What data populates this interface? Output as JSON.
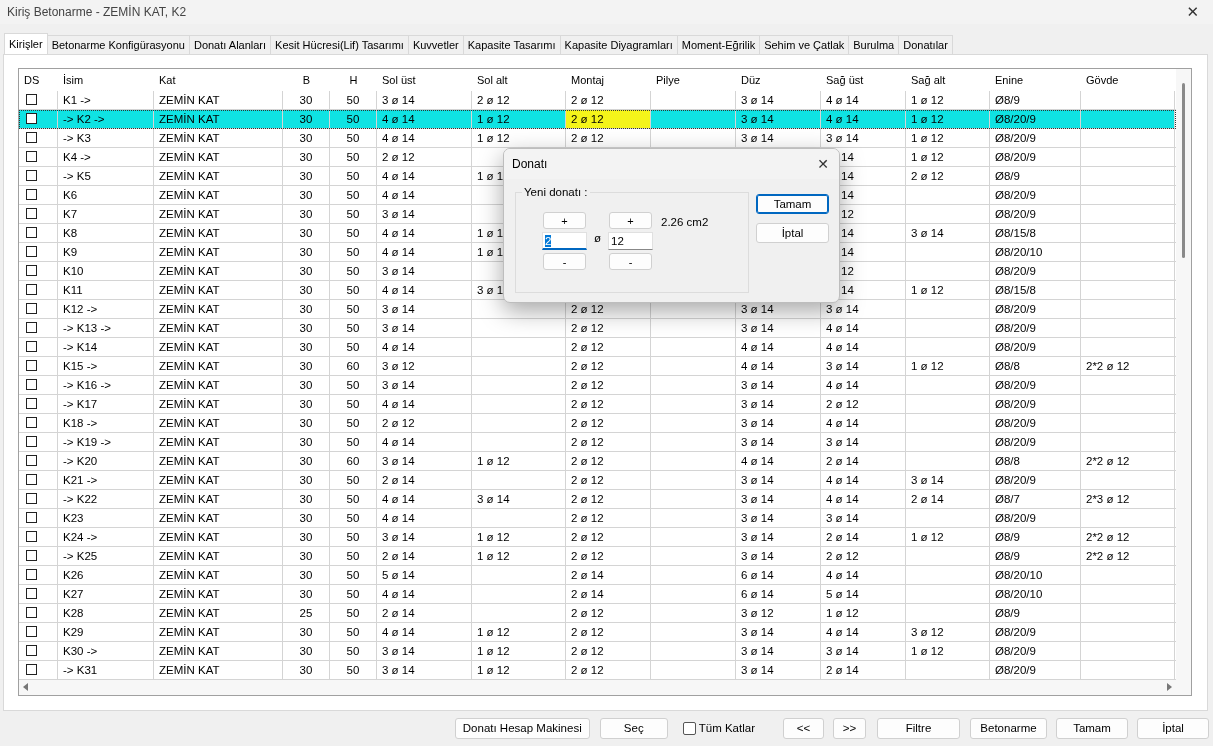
{
  "window": {
    "title": "Kiriş Betonarme - ZEMİN KAT, K2",
    "close": "✕"
  },
  "tabs": [
    {
      "label": "Kirişler",
      "selected": true
    },
    {
      "label": "Betonarme Konfigürasyonu",
      "selected": false
    },
    {
      "label": "Donatı Alanları",
      "selected": false
    },
    {
      "label": "Kesit Hücresi(Lif) Tasarımı",
      "selected": false
    },
    {
      "label": "Kuvvetler",
      "selected": false
    },
    {
      "label": "Kapasite Tasarımı",
      "selected": false
    },
    {
      "label": "Kapasite Diyagramları",
      "selected": false
    },
    {
      "label": "Moment-Eğrilik",
      "selected": false
    },
    {
      "label": "Sehim ve Çatlak",
      "selected": false
    },
    {
      "label": "Burulma",
      "selected": false
    },
    {
      "label": "Donatılar",
      "selected": false
    }
  ],
  "table": {
    "columns": [
      "DS",
      "İsim",
      "Kat",
      "B",
      "H",
      "Sol üst",
      "Sol alt",
      "Montaj",
      "Pilye",
      "Düz",
      "Sağ üst",
      "Sağ alt",
      "Enine",
      "Gövde"
    ],
    "rows": [
      {
        "selected": false,
        "cells": [
          {
            "checked": false
          },
          "K1 ->",
          "ZEMİN KAT",
          "30",
          "50",
          "3 ø 14",
          "2 ø 12",
          "2 ø 12",
          null,
          "3 ø 14",
          "4 ø 14",
          "1 ø 12",
          "Ø8/9",
          null
        ]
      },
      {
        "selected": true,
        "cells": [
          {
            "checked": false
          },
          "-> K2 ->",
          "ZEMİN KAT",
          "30",
          "50",
          "4 ø 14",
          "1 ø 12",
          {
            "text": "2 ø 12",
            "current": true
          },
          null,
          "3 ø 14",
          "4 ø 14",
          "1 ø 12",
          "Ø8/20/9",
          null
        ]
      },
      {
        "selected": false,
        "cells": [
          {
            "checked": false
          },
          "-> K3",
          "ZEMİN KAT",
          "30",
          "50",
          "4 ø 14",
          "1 ø 12",
          "2 ø 12",
          null,
          "3 ø 14",
          "3 ø 14",
          "1 ø 12",
          "Ø8/20/9",
          null
        ]
      },
      {
        "selected": false,
        "cells": [
          {
            "checked": false
          },
          "K4 ->",
          "ZEMİN KAT",
          "30",
          "50",
          "2 ø 12",
          null,
          null,
          null,
          null,
          {
            "text": "14",
            "clipped": true
          },
          "1 ø 12",
          "Ø8/20/9",
          null
        ]
      },
      {
        "selected": false,
        "cells": [
          {
            "checked": false
          },
          "-> K5",
          "ZEMİN KAT",
          "30",
          "50",
          "4 ø 14",
          "1 ø 1",
          null,
          null,
          null,
          {
            "text": "14",
            "clipped": true
          },
          "2 ø 12",
          "Ø8/9",
          null
        ]
      },
      {
        "selected": false,
        "cells": [
          {
            "checked": false
          },
          "K6",
          "ZEMİN KAT",
          "30",
          "50",
          "4 ø 14",
          null,
          null,
          null,
          null,
          {
            "text": "14",
            "clipped": true
          },
          null,
          "Ø8/20/9",
          null
        ]
      },
      {
        "selected": false,
        "cells": [
          {
            "checked": false
          },
          "K7",
          "ZEMİN KAT",
          "30",
          "50",
          "3 ø 14",
          null,
          null,
          null,
          null,
          {
            "text": "12",
            "clipped": true
          },
          null,
          "Ø8/20/9",
          null
        ]
      },
      {
        "selected": false,
        "cells": [
          {
            "checked": false
          },
          "K8",
          "ZEMİN KAT",
          "30",
          "50",
          "4 ø 14",
          "1 ø 1",
          null,
          null,
          null,
          {
            "text": "14",
            "clipped": true
          },
          "3 ø 14",
          "Ø8/15/8",
          null
        ]
      },
      {
        "selected": false,
        "cells": [
          {
            "checked": false
          },
          "K9",
          "ZEMİN KAT",
          "30",
          "50",
          "4 ø 14",
          "1 ø 1",
          null,
          null,
          null,
          {
            "text": "14",
            "clipped": true
          },
          null,
          "Ø8/20/10",
          null
        ]
      },
      {
        "selected": false,
        "cells": [
          {
            "checked": false
          },
          "K10",
          "ZEMİN KAT",
          "30",
          "50",
          "3 ø 14",
          null,
          null,
          null,
          null,
          {
            "text": "12",
            "clipped": true
          },
          null,
          "Ø8/20/9",
          null
        ]
      },
      {
        "selected": false,
        "cells": [
          {
            "checked": false
          },
          "K11",
          "ZEMİN KAT",
          "30",
          "50",
          "4 ø 14",
          "3 ø 1",
          null,
          null,
          null,
          {
            "text": "14",
            "clipped": true
          },
          "1 ø 12",
          "Ø8/15/8",
          null
        ]
      },
      {
        "selected": false,
        "cells": [
          {
            "checked": false
          },
          "K12 ->",
          "ZEMİN KAT",
          "30",
          "50",
          "3 ø 14",
          null,
          "2 ø 12",
          null,
          "3 ø 14",
          "3 ø 14",
          null,
          "Ø8/20/9",
          null
        ]
      },
      {
        "selected": false,
        "cells": [
          {
            "checked": false
          },
          "-> K13 ->",
          "ZEMİN KAT",
          "30",
          "50",
          "3 ø 14",
          null,
          "2 ø 12",
          null,
          "3 ø 14",
          "4 ø 14",
          null,
          "Ø8/20/9",
          null
        ]
      },
      {
        "selected": false,
        "cells": [
          {
            "checked": false
          },
          "-> K14",
          "ZEMİN KAT",
          "30",
          "50",
          "4 ø 14",
          null,
          "2 ø 12",
          null,
          "4 ø 14",
          "4 ø 14",
          null,
          "Ø8/20/9",
          null
        ]
      },
      {
        "selected": false,
        "cells": [
          {
            "checked": false
          },
          "K15 ->",
          "ZEMİN KAT",
          "30",
          "60",
          "3 ø 12",
          null,
          "2 ø 12",
          null,
          "4 ø 14",
          "3 ø 14",
          "1 ø 12",
          "Ø8/8",
          "2*2 ø 12"
        ]
      },
      {
        "selected": false,
        "cells": [
          {
            "checked": false
          },
          "-> K16 ->",
          "ZEMİN KAT",
          "30",
          "50",
          "3 ø 14",
          null,
          "2 ø 12",
          null,
          "3 ø 14",
          "4 ø 14",
          null,
          "Ø8/20/9",
          null
        ]
      },
      {
        "selected": false,
        "cells": [
          {
            "checked": false
          },
          "-> K17",
          "ZEMİN KAT",
          "30",
          "50",
          "4 ø 14",
          null,
          "2 ø 12",
          null,
          "3 ø 14",
          "2 ø 12",
          null,
          "Ø8/20/9",
          null
        ]
      },
      {
        "selected": false,
        "cells": [
          {
            "checked": false
          },
          "K18 ->",
          "ZEMİN KAT",
          "30",
          "50",
          "2 ø 12",
          null,
          "2 ø 12",
          null,
          "3 ø 14",
          "4 ø 14",
          null,
          "Ø8/20/9",
          null
        ]
      },
      {
        "selected": false,
        "cells": [
          {
            "checked": false
          },
          "-> K19 ->",
          "ZEMİN KAT",
          "30",
          "50",
          "4 ø 14",
          null,
          "2 ø 12",
          null,
          "3 ø 14",
          "3 ø 14",
          null,
          "Ø8/20/9",
          null
        ]
      },
      {
        "selected": false,
        "cells": [
          {
            "checked": false
          },
          "-> K20",
          "ZEMİN KAT",
          "30",
          "60",
          "3 ø 14",
          "1 ø 12",
          "2 ø 12",
          null,
          "4 ø 14",
          "2 ø 14",
          null,
          "Ø8/8",
          "2*2 ø 12"
        ]
      },
      {
        "selected": false,
        "cells": [
          {
            "checked": false
          },
          "K21 ->",
          "ZEMİN KAT",
          "30",
          "50",
          "2 ø 14",
          null,
          "2 ø 12",
          null,
          "3 ø 14",
          "4 ø 14",
          "3 ø 14",
          "Ø8/20/9",
          null
        ]
      },
      {
        "selected": false,
        "cells": [
          {
            "checked": false
          },
          "-> K22",
          "ZEMİN KAT",
          "30",
          "50",
          "4 ø 14",
          "3 ø 14",
          "2 ø 12",
          null,
          "3 ø 14",
          "4 ø 14",
          "2 ø 14",
          "Ø8/7",
          "2*3 ø 12"
        ]
      },
      {
        "selected": false,
        "cells": [
          {
            "checked": false
          },
          "K23",
          "ZEMİN KAT",
          "30",
          "50",
          "4 ø 14",
          null,
          "2 ø 12",
          null,
          "3 ø 14",
          "3 ø 14",
          null,
          "Ø8/20/9",
          null
        ]
      },
      {
        "selected": false,
        "cells": [
          {
            "checked": false
          },
          "K24 ->",
          "ZEMİN KAT",
          "30",
          "50",
          "3 ø 14",
          "1 ø 12",
          "2 ø 12",
          null,
          "3 ø 14",
          "2 ø 14",
          "1 ø 12",
          "Ø8/9",
          "2*2 ø 12"
        ]
      },
      {
        "selected": false,
        "cells": [
          {
            "checked": false
          },
          "-> K25",
          "ZEMİN KAT",
          "30",
          "50",
          "2 ø 14",
          "1 ø 12",
          "2 ø 12",
          null,
          "3 ø 14",
          "2 ø 12",
          null,
          "Ø8/9",
          "2*2 ø 12"
        ]
      },
      {
        "selected": false,
        "cells": [
          {
            "checked": false
          },
          "K26",
          "ZEMİN KAT",
          "30",
          "50",
          "5 ø 14",
          null,
          "2 ø 14",
          null,
          "6 ø 14",
          "4 ø 14",
          null,
          "Ø8/20/10",
          null
        ]
      },
      {
        "selected": false,
        "cells": [
          {
            "checked": false
          },
          "K27",
          "ZEMİN KAT",
          "30",
          "50",
          "4 ø 14",
          null,
          "2 ø 14",
          null,
          "6 ø 14",
          "5 ø 14",
          null,
          "Ø8/20/10",
          null
        ]
      },
      {
        "selected": false,
        "cells": [
          {
            "checked": false
          },
          "K28",
          "ZEMİN KAT",
          "25",
          "50",
          "2 ø 14",
          null,
          "2 ø 12",
          null,
          "3 ø 12",
          "1 ø 12",
          null,
          "Ø8/9",
          null
        ]
      },
      {
        "selected": false,
        "cells": [
          {
            "checked": false
          },
          "K29",
          "ZEMİN KAT",
          "30",
          "50",
          "4 ø 14",
          "1 ø 12",
          "2 ø 12",
          null,
          "3 ø 14",
          "4 ø 14",
          "3 ø 12",
          "Ø8/20/9",
          null
        ]
      },
      {
        "selected": false,
        "cells": [
          {
            "checked": false
          },
          "K30 ->",
          "ZEMİN KAT",
          "30",
          "50",
          "3 ø 14",
          "1 ø 12",
          "2 ø 12",
          null,
          "3 ø 14",
          "3 ø 14",
          "1 ø 12",
          "Ø8/20/9",
          null
        ]
      },
      {
        "selected": false,
        "cells": [
          {
            "checked": false
          },
          "-> K31",
          "ZEMİN KAT",
          "30",
          "50",
          "3 ø 14",
          "1 ø 12",
          "2 ø 12",
          null,
          "3 ø 14",
          "2 ø 14",
          null,
          "Ø8/20/9",
          null
        ]
      }
    ]
  },
  "dialog": {
    "title": "Donatı",
    "close": "✕",
    "group_label": "Yeni donatı :",
    "count": {
      "value": "2",
      "text_selected": true,
      "plus": "+",
      "minus": "-"
    },
    "separator": "ø",
    "diameter": {
      "value": "12",
      "text_selected": false,
      "plus": "+",
      "minus": "-"
    },
    "area": "2.26 cm2",
    "buttons": [
      {
        "label": "Tamam",
        "default": true
      },
      {
        "label": "İptal",
        "default": false
      }
    ]
  },
  "bottom_bar": [
    {
      "kind": "button",
      "label": "Donatı Hesap Makinesi"
    },
    {
      "kind": "button",
      "label": "Seç"
    },
    {
      "kind": "checkbox",
      "label": "Tüm Katlar",
      "checked": false
    },
    {
      "kind": "button",
      "label": "<<"
    },
    {
      "kind": "button",
      "label": ">>"
    },
    {
      "kind": "button",
      "label": "Filtre"
    },
    {
      "kind": "button",
      "label": "Betonarme"
    },
    {
      "kind": "button",
      "label": "Tamam"
    },
    {
      "kind": "button",
      "label": "İptal"
    }
  ]
}
